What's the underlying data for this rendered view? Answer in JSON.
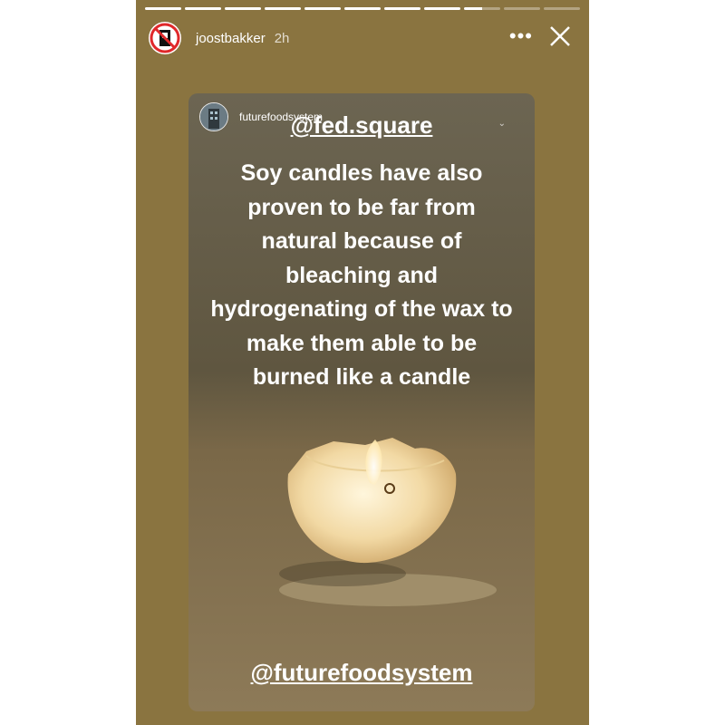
{
  "story": {
    "username": "joostbakker",
    "time": "2h",
    "progress": {
      "segments": 11,
      "completed": 8,
      "current_fraction": 0.5
    },
    "icons": {
      "more": "more-dots-icon",
      "close": "close-icon"
    }
  },
  "shared_post": {
    "account": "futurefoodsystem",
    "mention_top": "@fed.square",
    "caption": "Soy candles have also proven to be far from natural because of bleaching and hydrogenating of the wax to make them able to be burned like a candle",
    "mention_bottom": "@futurefoodsystem"
  },
  "colors": {
    "story_background": "#8a7440",
    "text": "#ffffff"
  }
}
